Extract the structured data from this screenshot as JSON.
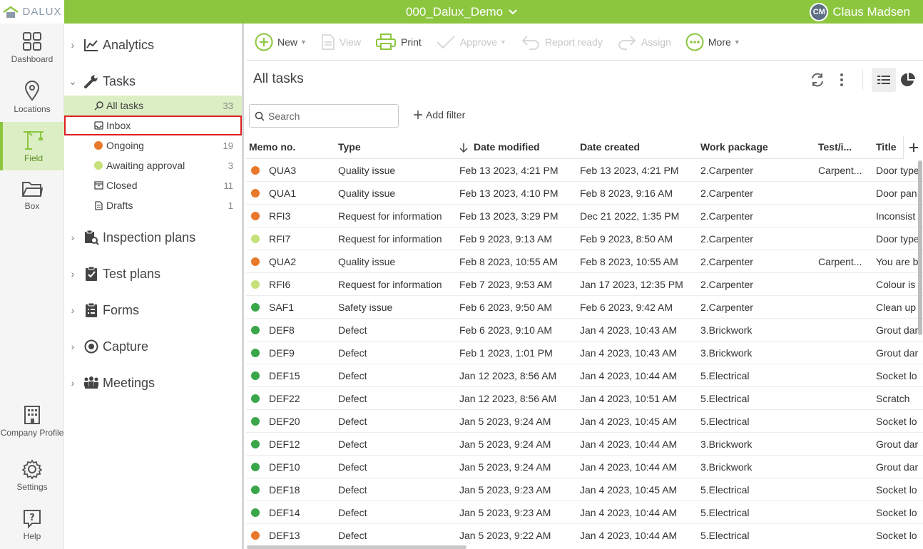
{
  "app": {
    "logo_text": "DALUX",
    "project": "000_Dalux_Demo",
    "user_name": "Claus Madsen",
    "user_initials": "CM"
  },
  "colors": {
    "brand_green": "#8cc63f",
    "status_orange": "#e8792b",
    "status_lightgreen": "#c6e17a",
    "status_green": "#3aa64a"
  },
  "rail": [
    {
      "label": "Dashboard",
      "icon": "dashboard-icon"
    },
    {
      "label": "Locations",
      "icon": "location-pin-icon"
    },
    {
      "label": "Field",
      "icon": "crane-icon"
    },
    {
      "label": "Box",
      "icon": "folder-icon"
    },
    {
      "label": "Company Profile",
      "icon": "building-icon"
    },
    {
      "label": "Settings",
      "icon": "gear-icon"
    },
    {
      "label": "Help",
      "icon": "help-icon"
    }
  ],
  "nav": {
    "analytics": "Analytics",
    "tasks": "Tasks",
    "tasks_items": [
      {
        "label": "All tasks",
        "count": "33"
      },
      {
        "label": "Inbox",
        "count": ""
      },
      {
        "label": "Ongoing",
        "count": "19"
      },
      {
        "label": "Awaiting approval",
        "count": "3"
      },
      {
        "label": "Closed",
        "count": "11"
      },
      {
        "label": "Drafts",
        "count": "1"
      }
    ],
    "inspection_plans": "Inspection plans",
    "test_plans": "Test plans",
    "forms": "Forms",
    "capture": "Capture",
    "meetings": "Meetings"
  },
  "toolbar": {
    "new": "New",
    "view": "View",
    "print": "Print",
    "approve": "Approve",
    "report_ready": "Report ready",
    "assign": "Assign",
    "more": "More"
  },
  "page": {
    "title": "All tasks",
    "search_placeholder": "Search",
    "add_filter": "Add filter"
  },
  "table": {
    "columns": [
      "Memo no.",
      "Type",
      "Date modified",
      "Date created",
      "Work package",
      "Test/i...",
      "Title"
    ],
    "rows": [
      {
        "status": "orange",
        "memo": "QUA3",
        "type": "Quality issue",
        "modified": "Feb 13 2023, 4:21 PM",
        "created": "Feb 13 2023, 4:21 PM",
        "wp": "2.Carpenter",
        "test": "Carpent...",
        "title": "Door type"
      },
      {
        "status": "orange",
        "memo": "QUA1",
        "type": "Quality issue",
        "modified": "Feb 13 2023, 4:10 PM",
        "created": "Feb 8 2023, 9:16 AM",
        "wp": "2.Carpenter",
        "test": "",
        "title": "Door pan"
      },
      {
        "status": "orange",
        "memo": "RFI3",
        "type": "Request for information",
        "modified": "Feb 13 2023, 3:29 PM",
        "created": "Dec 21 2022, 1:35 PM",
        "wp": "2.Carpenter",
        "test": "",
        "title": "Inconsist"
      },
      {
        "status": "lightgreen",
        "memo": "RFI7",
        "type": "Request for information",
        "modified": "Feb 9 2023, 9:13 AM",
        "created": "Feb 9 2023, 8:50 AM",
        "wp": "2.Carpenter",
        "test": "",
        "title": "Door type"
      },
      {
        "status": "orange",
        "memo": "QUA2",
        "type": "Quality issue",
        "modified": "Feb 8 2023, 10:55 AM",
        "created": "Feb 8 2023, 10:55 AM",
        "wp": "2.Carpenter",
        "test": "Carpent...",
        "title": "You are b"
      },
      {
        "status": "lightgreen",
        "memo": "RFI6",
        "type": "Request for information",
        "modified": "Feb 7 2023, 9:53 AM",
        "created": "Jan 17 2023, 12:35 PM",
        "wp": "2.Carpenter",
        "test": "",
        "title": "Colour is"
      },
      {
        "status": "green",
        "memo": "SAF1",
        "type": "Safety issue",
        "modified": "Feb 6 2023, 9:50 AM",
        "created": "Feb 6 2023, 9:42 AM",
        "wp": "2.Carpenter",
        "test": "",
        "title": "Clean up"
      },
      {
        "status": "green",
        "memo": "DEF8",
        "type": "Defect",
        "modified": "Feb 6 2023, 9:10 AM",
        "created": "Jan 4 2023, 10:43 AM",
        "wp": "3.Brickwork",
        "test": "",
        "title": "Grout dar"
      },
      {
        "status": "green",
        "memo": "DEF9",
        "type": "Defect",
        "modified": "Feb 1 2023, 1:01 PM",
        "created": "Jan 4 2023, 10:43 AM",
        "wp": "3.Brickwork",
        "test": "",
        "title": "Grout dar"
      },
      {
        "status": "green",
        "memo": "DEF15",
        "type": "Defect",
        "modified": "Jan 12 2023, 8:56 AM",
        "created": "Jan 4 2023, 10:44 AM",
        "wp": "5.Electrical",
        "test": "",
        "title": "Socket lo"
      },
      {
        "status": "green",
        "memo": "DEF22",
        "type": "Defect",
        "modified": "Jan 12 2023, 8:56 AM",
        "created": "Jan 4 2023, 10:51 AM",
        "wp": "5.Electrical",
        "test": "",
        "title": "Scratch"
      },
      {
        "status": "green",
        "memo": "DEF20",
        "type": "Defect",
        "modified": "Jan 5 2023, 9:24 AM",
        "created": "Jan 4 2023, 10:45 AM",
        "wp": "5.Electrical",
        "test": "",
        "title": "Socket lo"
      },
      {
        "status": "green",
        "memo": "DEF12",
        "type": "Defect",
        "modified": "Jan 5 2023, 9:24 AM",
        "created": "Jan 4 2023, 10:44 AM",
        "wp": "3.Brickwork",
        "test": "",
        "title": "Grout dar"
      },
      {
        "status": "green",
        "memo": "DEF10",
        "type": "Defect",
        "modified": "Jan 5 2023, 9:24 AM",
        "created": "Jan 4 2023, 10:44 AM",
        "wp": "3.Brickwork",
        "test": "",
        "title": "Grout dar"
      },
      {
        "status": "green",
        "memo": "DEF18",
        "type": "Defect",
        "modified": "Jan 5 2023, 9:23 AM",
        "created": "Jan 4 2023, 10:45 AM",
        "wp": "5.Electrical",
        "test": "",
        "title": "Socket lo"
      },
      {
        "status": "green",
        "memo": "DEF14",
        "type": "Defect",
        "modified": "Jan 5 2023, 9:23 AM",
        "created": "Jan 4 2023, 10:44 AM",
        "wp": "5.Electrical",
        "test": "",
        "title": "Socket lo"
      },
      {
        "status": "orange",
        "memo": "DEF13",
        "type": "Defect",
        "modified": "Jan 5 2023, 9:22 AM",
        "created": "Jan 4 2023, 10:44 AM",
        "wp": "5.Electrical",
        "test": "",
        "title": "Socket lo"
      }
    ]
  }
}
